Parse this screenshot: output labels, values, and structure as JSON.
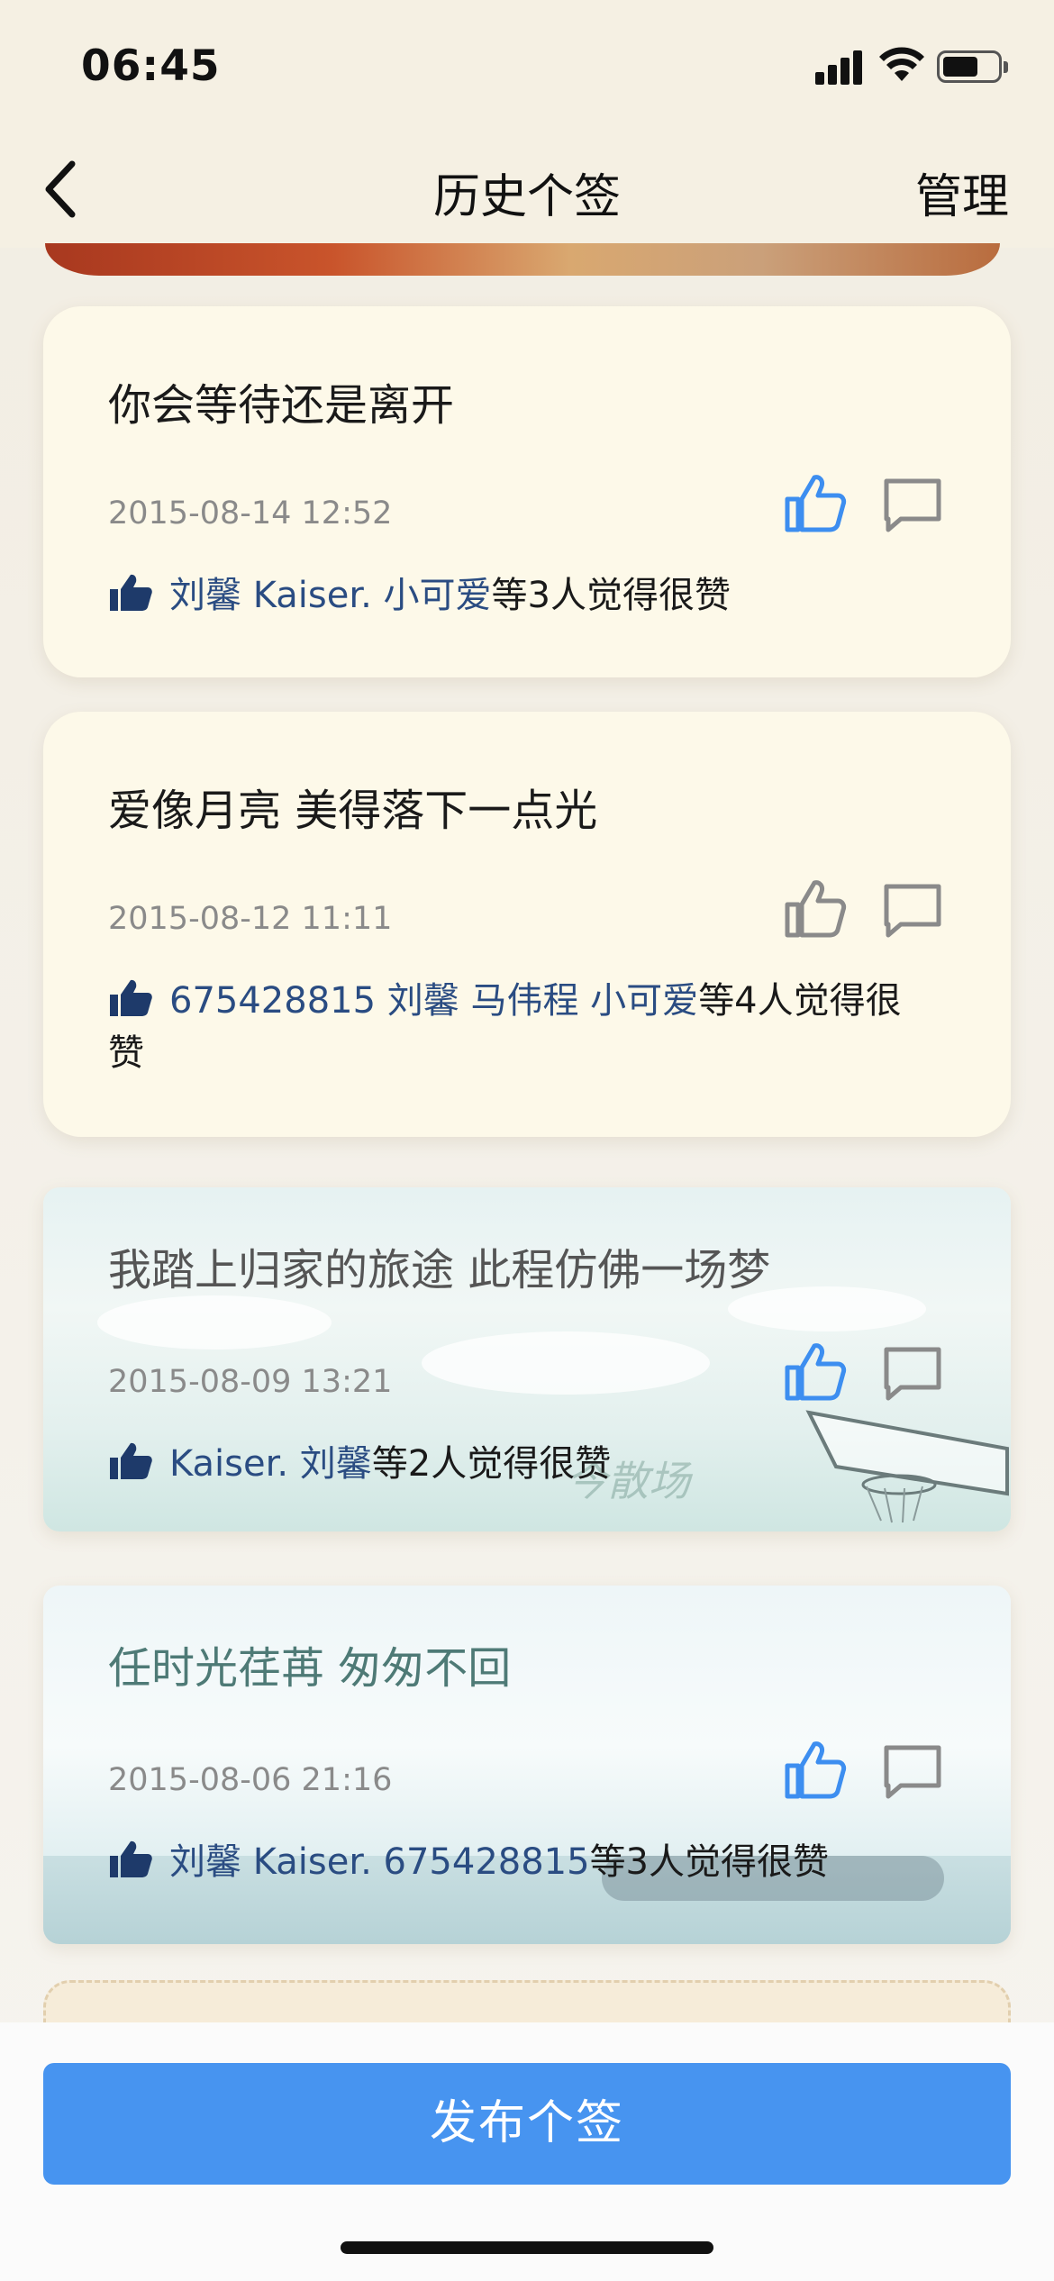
{
  "status_bar": {
    "time": "06:45"
  },
  "nav": {
    "title": "历史个签",
    "manage_label": "管理"
  },
  "colors": {
    "accent_blue": "#4794f0",
    "like_active": "#3d8ef0",
    "like_inactive": "#8a8a8a",
    "name_link": "#2a4c82"
  },
  "cards": [
    {
      "text": "你会等待还是离开",
      "date": "2015-08-14 12:52",
      "liked": true,
      "like_names": "刘馨 Kaiser. 小可爱",
      "like_suffix": "等3人觉得很赞"
    },
    {
      "text": "爱像月亮 美得落下一点光",
      "date": "2015-08-12 11:11",
      "liked": false,
      "like_names": "675428815 刘馨 马伟程 小可爱",
      "like_suffix": "等4人觉得很赞"
    },
    {
      "text": "我踏上归家的旅途 此程仿佛一场梦",
      "date": "2015-08-09 13:21",
      "liked": true,
      "like_names": "Kaiser. 刘馨",
      "like_suffix": "等2人觉得很赞",
      "scene_text": "今散场"
    },
    {
      "text": "任时光荏苒 匆匆不回",
      "date": "2015-08-06 21:16",
      "liked": true,
      "like_names": "刘馨 Kaiser. 675428815",
      "like_suffix": "等3人觉得很赞"
    }
  ],
  "bottom": {
    "publish_label": "发布个签"
  }
}
